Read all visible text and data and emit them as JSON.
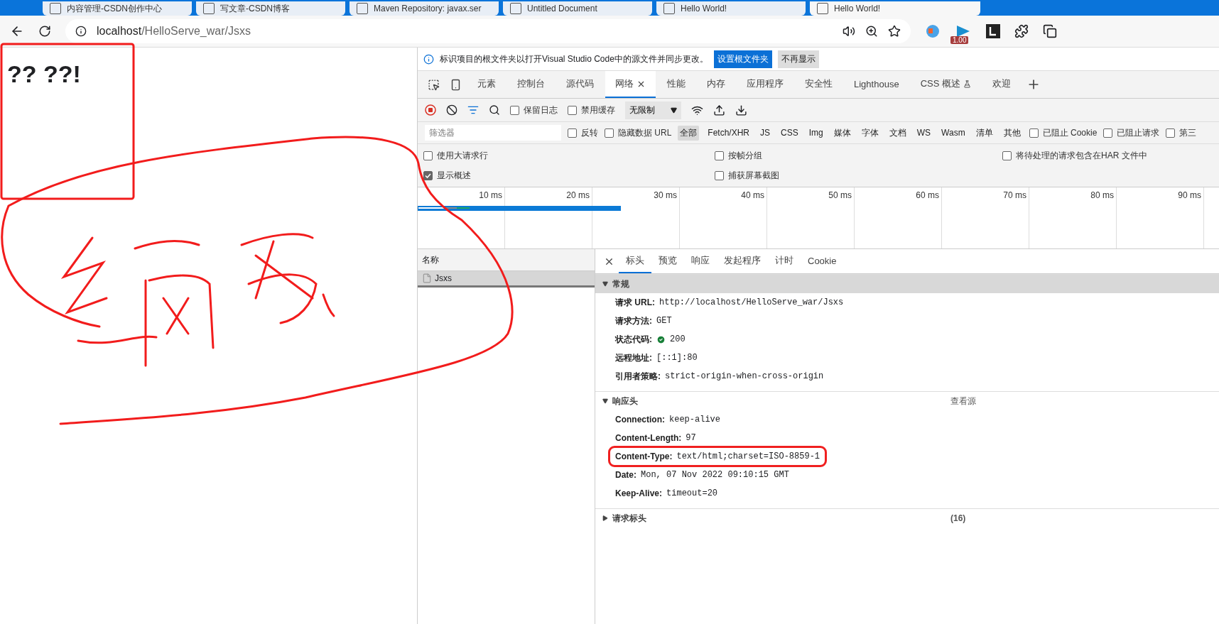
{
  "browser": {
    "tabs": [
      {
        "title": "内容管理-CSDN创作中心",
        "selected": false
      },
      {
        "title": "写文章-CSDN博客",
        "selected": false
      },
      {
        "title": "Maven Repository: javax.ser",
        "selected": false
      },
      {
        "title": "Untitled Document",
        "selected": false
      },
      {
        "title": "Hello World!",
        "selected": false
      },
      {
        "title": "Hello World!",
        "selected": true
      }
    ],
    "address": {
      "host": "localhost",
      "path": "/HelloServe_war/Jsxs"
    },
    "extension_badge": "1.00"
  },
  "page": {
    "heading": "?? ??!"
  },
  "devtools": {
    "infobar": {
      "message": "标识项目的根文件夹以打开Visual Studio Code中的源文件并同步更改。",
      "buttons": [
        {
          "label": "设置根文件夹",
          "primary": true
        },
        {
          "label": "不再显示",
          "primary": false
        }
      ]
    },
    "tabs": [
      {
        "label": "元素",
        "selected": false,
        "experimental": false
      },
      {
        "label": "控制台",
        "selected": false,
        "experimental": false
      },
      {
        "label": "源代码",
        "selected": false,
        "experimental": false
      },
      {
        "label": "网络",
        "selected": true,
        "experimental": false
      },
      {
        "label": "性能",
        "selected": false,
        "experimental": false
      },
      {
        "label": "内存",
        "selected": false,
        "experimental": false
      },
      {
        "label": "应用程序",
        "selected": false,
        "experimental": false
      },
      {
        "label": "安全性",
        "selected": false,
        "experimental": false
      },
      {
        "label": "Lighthouse",
        "selected": false,
        "experimental": false
      },
      {
        "label": "CSS 概述",
        "selected": false,
        "experimental": true
      },
      {
        "label": "欢迎",
        "selected": false,
        "experimental": false
      }
    ],
    "toolbar": {
      "recording": true,
      "checkboxes": [
        {
          "label": "保留日志",
          "checked": false
        },
        {
          "label": "禁用缓存",
          "checked": false
        }
      ],
      "throttle": "无限制"
    },
    "filter": {
      "placeholder": "筛选器",
      "checkboxes": [
        {
          "label": "反转",
          "checked": false
        },
        {
          "label": "隐藏数据 URL",
          "checked": false
        }
      ],
      "types": [
        {
          "label": "全部",
          "selected": true
        },
        {
          "label": "Fetch/XHR",
          "selected": false
        },
        {
          "label": "JS",
          "selected": false
        },
        {
          "label": "CSS",
          "selected": false
        },
        {
          "label": "Img",
          "selected": false
        },
        {
          "label": "媒体",
          "selected": false
        },
        {
          "label": "字体",
          "selected": false
        },
        {
          "label": "文档",
          "selected": false
        },
        {
          "label": "WS",
          "selected": false
        },
        {
          "label": "Wasm",
          "selected": false
        },
        {
          "label": "清单",
          "selected": false
        },
        {
          "label": "其他",
          "selected": false
        }
      ],
      "extra_checkboxes": [
        {
          "label": "已阻止 Cookie",
          "checked": false
        },
        {
          "label": "已阻止请求",
          "checked": false
        },
        {
          "label": "第三",
          "checked": false
        }
      ]
    },
    "options": [
      {
        "label": "使用大请求行",
        "checked": false
      },
      {
        "label": "按帧分组",
        "checked": false
      },
      {
        "label": "将待处理的请求包含在HAR 文件中",
        "checked": false
      },
      {
        "label": "显示概述",
        "checked": true
      },
      {
        "label": "捕获屏幕截图",
        "checked": false
      }
    ],
    "timeline_ticks": [
      "10 ms",
      "20 ms",
      "30 ms",
      "40 ms",
      "50 ms",
      "60 ms",
      "70 ms",
      "80 ms",
      "90 ms"
    ],
    "requests": {
      "column": "名称",
      "rows": [
        {
          "name": "Jsxs",
          "selected": true
        }
      ]
    },
    "details": {
      "tabs": [
        {
          "label": "标头",
          "selected": true
        },
        {
          "label": "预览",
          "selected": false
        },
        {
          "label": "响应",
          "selected": false
        },
        {
          "label": "发起程序",
          "selected": false
        },
        {
          "label": "计时",
          "selected": false
        },
        {
          "label": "Cookie",
          "selected": false
        }
      ],
      "sections": [
        {
          "title": "常规",
          "expanded": true,
          "focused": true,
          "rows": [
            {
              "key": "请求 URL:",
              "value": "http://localhost/HelloServe_war/Jsxs",
              "status_ok": false,
              "highlighted": false
            },
            {
              "key": "请求方法:",
              "value": "GET",
              "status_ok": false,
              "highlighted": false
            },
            {
              "key": "状态代码:",
              "value": "200",
              "status_ok": true,
              "highlighted": false
            },
            {
              "key": "远程地址:",
              "value": "[::1]:80",
              "status_ok": false,
              "highlighted": false
            },
            {
              "key": "引用者策略:",
              "value": "strict-origin-when-cross-origin",
              "status_ok": false,
              "highlighted": false
            }
          ]
        },
        {
          "title": "响应头",
          "expanded": true,
          "focused": false,
          "link": "查看源",
          "rows": [
            {
              "key": "Connection:",
              "value": "keep-alive",
              "status_ok": false,
              "highlighted": false
            },
            {
              "key": "Content-Length:",
              "value": "97",
              "status_ok": false,
              "highlighted": false
            },
            {
              "key": "Content-Type:",
              "value": "text/html;charset=ISO-8859-1",
              "status_ok": false,
              "highlighted": true
            },
            {
              "key": "Date:",
              "value": "Mon, 07 Nov 2022 09:10:15 GMT",
              "status_ok": false,
              "highlighted": false
            },
            {
              "key": "Keep-Alive:",
              "value": "timeout=20",
              "status_ok": false,
              "highlighted": false
            }
          ]
        },
        {
          "title": "请求标头",
          "expanded": false,
          "focused": false,
          "count": "(16)"
        }
      ]
    }
  }
}
